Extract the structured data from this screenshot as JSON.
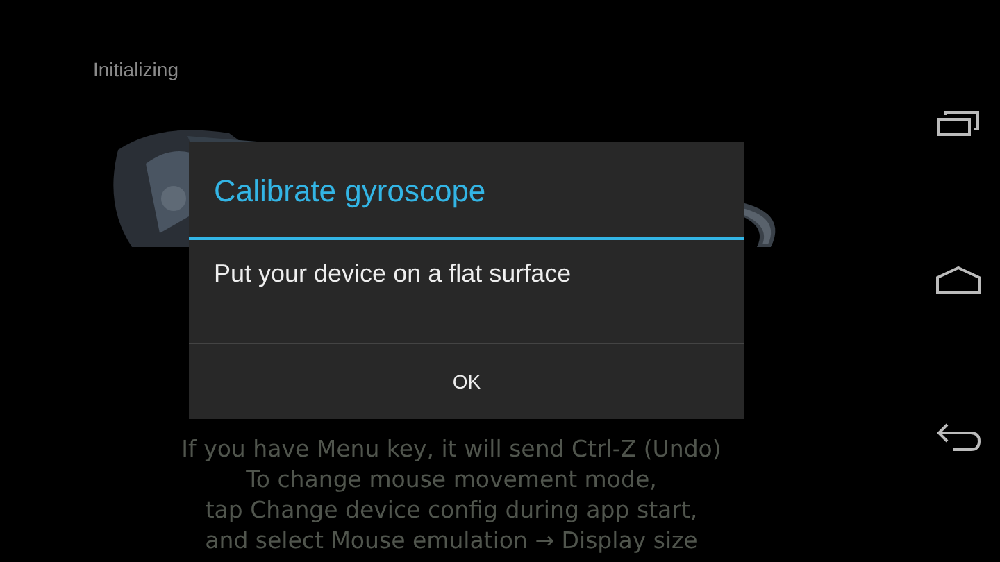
{
  "status": {
    "text": "Initializing"
  },
  "instructions": [
    "If you have Menu key, it will send Ctrl-Z (Undo)",
    "To change mouse movement mode,",
    "tap Change device config during app start,",
    "and select Mouse emulation → Display size"
  ],
  "dialog": {
    "title": "Calibrate gyroscope",
    "message": "Put your device on a flat surface",
    "buttons": [
      "OK"
    ]
  },
  "nav_bar": [
    {
      "kind": "recent"
    },
    {
      "kind": "home"
    },
    {
      "kind": "back"
    }
  ]
}
